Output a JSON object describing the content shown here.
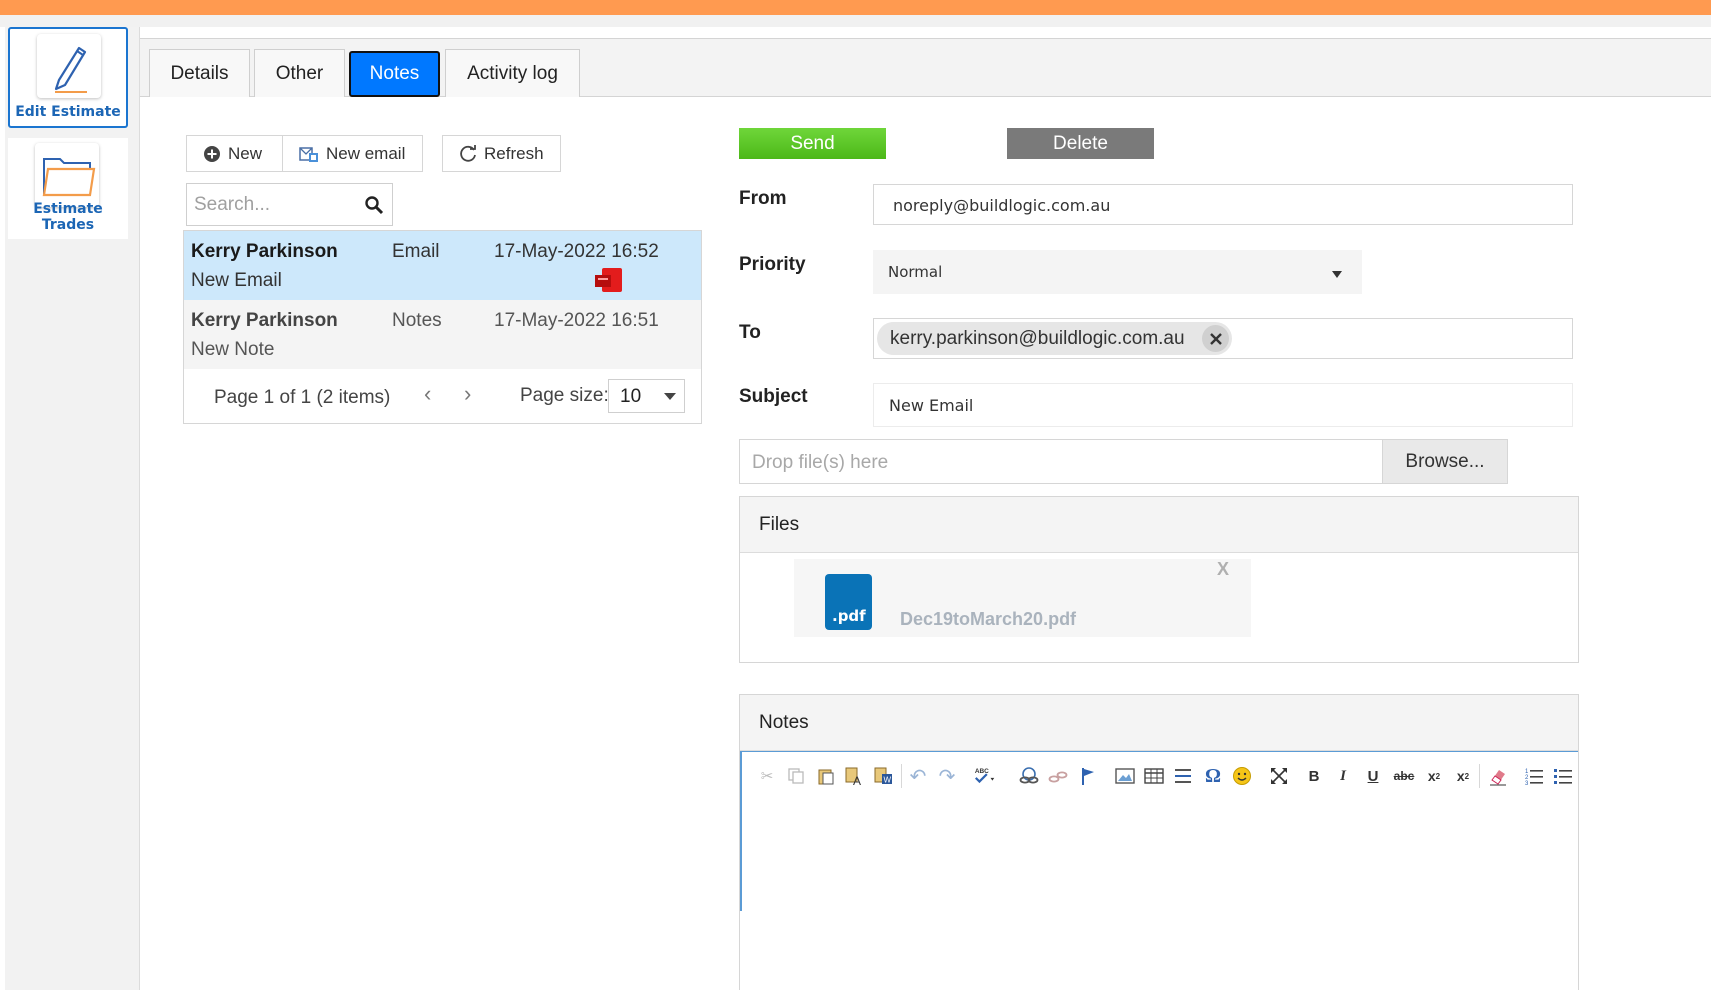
{
  "sidebar": {
    "items": [
      {
        "label": "Edit Estimate",
        "icon": "pencil-icon",
        "active": true
      },
      {
        "label": "Estimate Trades",
        "icon": "folder-icon",
        "active": false
      }
    ]
  },
  "tabs": [
    {
      "label": "Details",
      "selected": false
    },
    {
      "label": "Other",
      "selected": false
    },
    {
      "label": "Notes",
      "selected": true
    },
    {
      "label": "Activity log",
      "selected": false
    }
  ],
  "toolbar": {
    "new_label": "New",
    "new_email_label": "New email",
    "refresh_label": "Refresh"
  },
  "search": {
    "placeholder": "Search..."
  },
  "list": {
    "rows": [
      {
        "name": "Kerry Parkinson",
        "type": "Email",
        "date": "17-May-2022 16:52",
        "subject": "New Email",
        "has_attachment": true,
        "selected": true
      },
      {
        "name": "Kerry Parkinson",
        "type": "Notes",
        "date": "17-May-2022 16:51",
        "subject": "New Note",
        "has_attachment": false,
        "selected": false
      }
    ],
    "pager": {
      "info": "Page 1 of 1 (2 items)",
      "page_size_label": "Page size:",
      "page_size": "10"
    }
  },
  "form": {
    "send_label": "Send",
    "delete_label": "Delete",
    "from_label": "From",
    "from_value": "noreply@buildlogic.com.au",
    "priority_label": "Priority",
    "priority_value": "Normal",
    "to_label": "To",
    "to_recipients": [
      "kerry.parkinson@buildlogic.com.au"
    ],
    "subject_label": "Subject",
    "subject_value": "New Email",
    "drop_placeholder": "Drop file(s) here",
    "browse_label": "Browse...",
    "files_label": "Files",
    "files": [
      {
        "name": "Dec19toMarch20.pdf",
        "ext": ".pdf",
        "remove": "X"
      }
    ],
    "notes_label": "Notes"
  },
  "colors": {
    "accent": "#0078ff",
    "top_bar": "#ff9a50",
    "send": "#5cc428",
    "delete": "#7a7a7a",
    "selected_row": "#cde8fb",
    "file_icon": "#0a73b7"
  }
}
